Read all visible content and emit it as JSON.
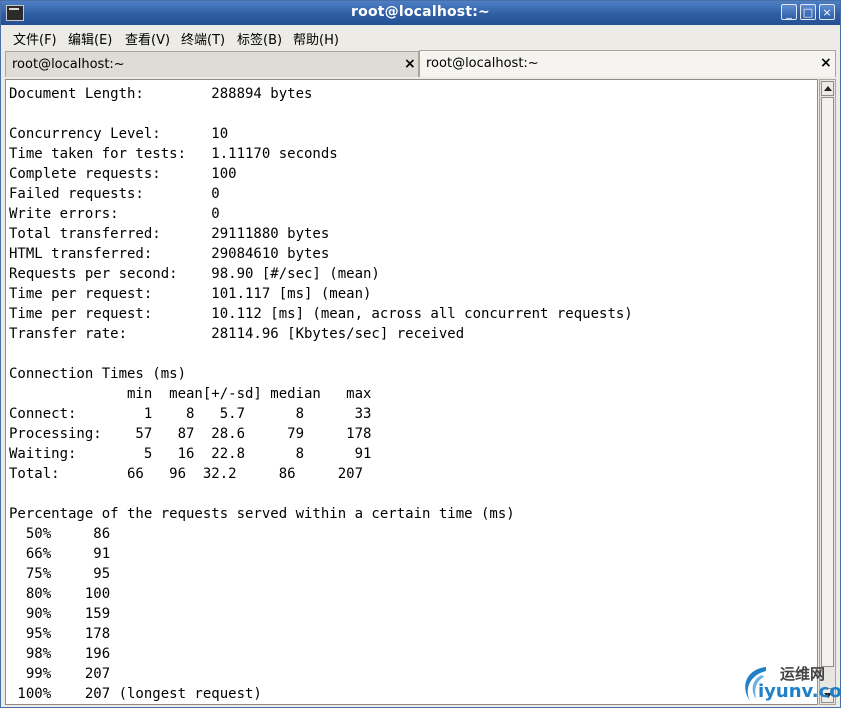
{
  "window": {
    "title": "root@localhost:~",
    "controls": {
      "minimize": "_",
      "maximize": "□",
      "close": "×"
    }
  },
  "menubar": {
    "items": [
      "文件(F)",
      "编辑(E)",
      "查看(V)",
      "终端(T)",
      "标签(B)",
      "帮助(H)"
    ]
  },
  "tabs": [
    {
      "label": "root@localhost:~",
      "close": "×",
      "active": false
    },
    {
      "label": "root@localhost:~",
      "close": "×",
      "active": true
    }
  ],
  "terminal": {
    "lines": [
      "Document Length:        288894 bytes",
      "",
      "Concurrency Level:      10",
      "Time taken for tests:   1.11170 seconds",
      "Complete requests:      100",
      "Failed requests:        0",
      "Write errors:           0",
      "Total transferred:      29111880 bytes",
      "HTML transferred:       29084610 bytes",
      "Requests per second:    98.90 [#/sec] (mean)",
      "Time per request:       101.117 [ms] (mean)",
      "Time per request:       10.112 [ms] (mean, across all concurrent requests)",
      "Transfer rate:          28114.96 [Kbytes/sec] received",
      "",
      "Connection Times (ms)",
      "              min  mean[+/-sd] median   max",
      "Connect:        1    8   5.7      8      33",
      "Processing:    57   87  28.6     79     178",
      "Waiting:        5   16  22.8      8      91",
      "Total:        66   96  32.2     86     207",
      "",
      "Percentage of the requests served within a certain time (ms)",
      "  50%     86",
      "  66%     91",
      "  75%     95",
      "  80%    100",
      "  90%    159",
      "  95%    178",
      "  98%    196",
      "  99%    207",
      " 100%    207 (longest request)"
    ]
  },
  "watermark": {
    "line1": "运维网",
    "line2": "iyunv.com"
  },
  "colors": {
    "titlebar": "#2f5ea5",
    "terminal_bg": "#ffffff",
    "watermark_blue": "#1f7fc9"
  }
}
